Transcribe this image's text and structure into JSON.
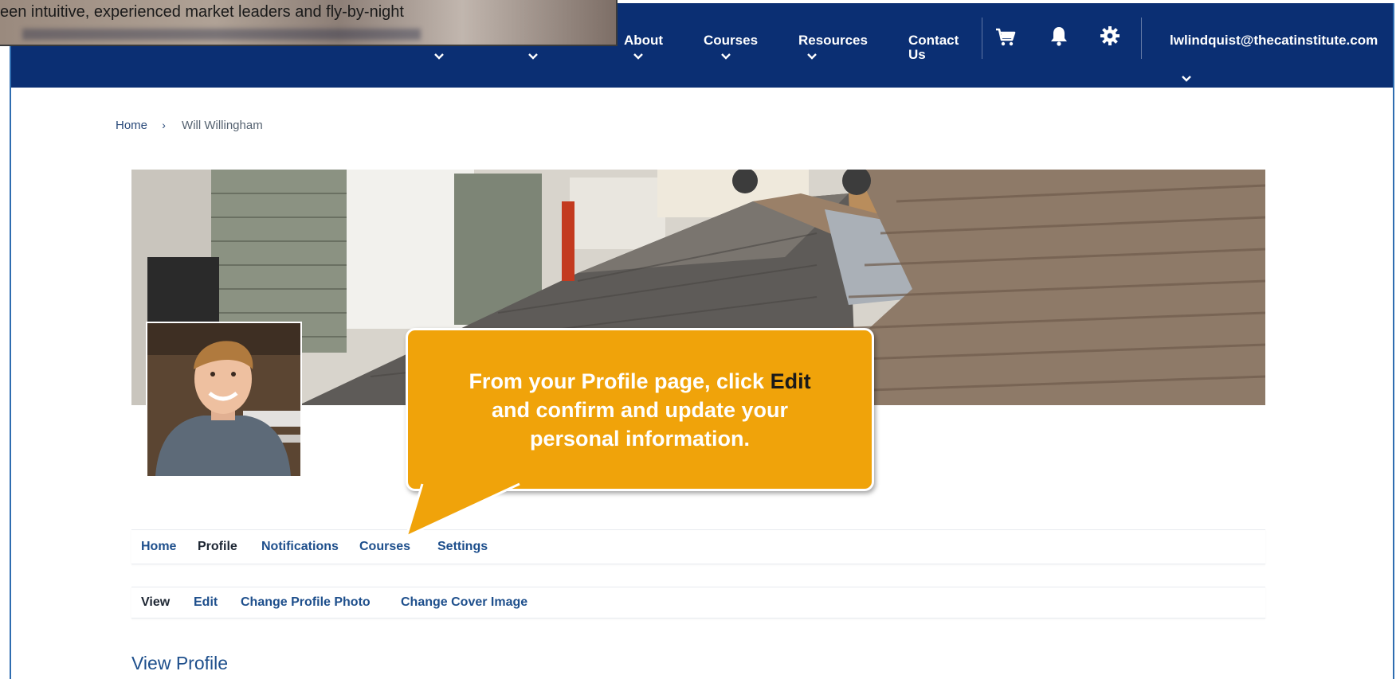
{
  "overlay_snippet": {
    "text": "een intuitive, experienced market leaders and fly-by-night"
  },
  "navbar": {
    "items": [
      {
        "label": "About"
      },
      {
        "label": "Courses"
      },
      {
        "label": "Resources"
      },
      {
        "label": "Contact Us"
      }
    ],
    "icons": [
      "cart-icon",
      "bell-icon",
      "gear-icon"
    ],
    "user_email": "lwlindquist@thecatinstitute.com"
  },
  "breadcrumb": {
    "home": "Home",
    "separator": "›",
    "current": "Will Willingham"
  },
  "callout": {
    "line_prefix": "From your Profile page, click",
    "emphasis": "Edit",
    "line_suffix": "and confirm and update your personal information."
  },
  "profile_tabs": [
    {
      "label": "Home",
      "active": false
    },
    {
      "label": "Profile",
      "active": true
    },
    {
      "label": "Notifications",
      "active": false
    },
    {
      "label": "Courses",
      "active": false
    },
    {
      "label": "Settings",
      "active": false
    }
  ],
  "profile_subtabs": [
    {
      "label": "View",
      "active": true
    },
    {
      "label": "Edit",
      "active": false
    },
    {
      "label": "Change Profile Photo",
      "active": false
    },
    {
      "label": "Change Cover Image",
      "active": false
    }
  ],
  "section_title": "View Profile",
  "colors": {
    "navbar": "#0b2f73",
    "callout": "#f0a30a",
    "link": "#1e4f8c"
  }
}
